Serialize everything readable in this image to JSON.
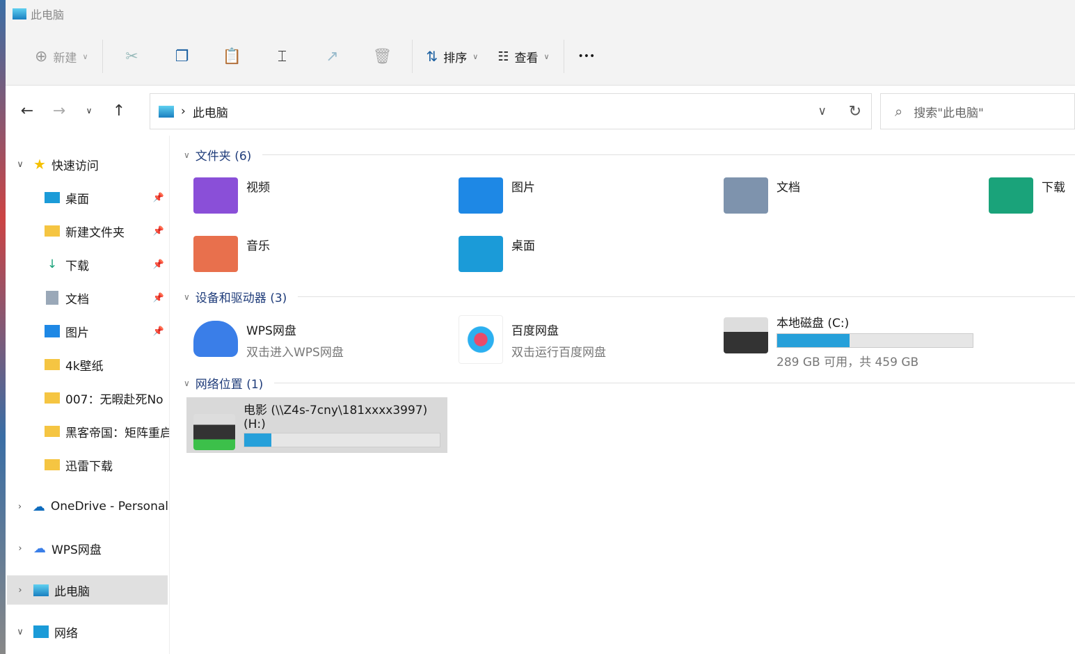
{
  "window": {
    "title": "此电脑"
  },
  "toolbar": {
    "new": "新建",
    "sort": "排序",
    "view": "查看",
    "more": "•••"
  },
  "address": {
    "path": "此电脑",
    "search_placeholder": "搜索\"此电脑\""
  },
  "sidebar": {
    "quick_access": "快速访问",
    "items": [
      {
        "label": "桌面"
      },
      {
        "label": "新建文件夹"
      },
      {
        "label": "下载"
      },
      {
        "label": "文档"
      },
      {
        "label": "图片"
      },
      {
        "label": "4k壁纸"
      },
      {
        "label": "007：无暇赴死No"
      },
      {
        "label": "黑客帝国：矩阵重启"
      },
      {
        "label": "迅雷下载"
      }
    ],
    "onedrive": "OneDrive - Personal",
    "wps": "WPS网盘",
    "this_pc": "此电脑",
    "network": "网络"
  },
  "groups": {
    "folders": "文件夹 (6)",
    "devices": "设备和驱动器 (3)",
    "network": "网络位置 (1)"
  },
  "folders": [
    {
      "label": "视频",
      "color": "#8a4fd8"
    },
    {
      "label": "图片",
      "color": "#1e88e5"
    },
    {
      "label": "文档",
      "color": "#7e93ad"
    },
    {
      "label": "下载",
      "color": "#1aa37a"
    },
    {
      "label": "音乐",
      "color": "#e8704d"
    },
    {
      "label": "桌面",
      "color": "#1b9bd8"
    }
  ],
  "devices": [
    {
      "name": "WPS网盘",
      "sub": "双击进入WPS网盘"
    },
    {
      "name": "百度网盘",
      "sub": "双击运行百度网盘"
    },
    {
      "name": "本地磁盘 (C:)",
      "sub": "289 GB 可用，共 459 GB",
      "used_percent": 37
    }
  ],
  "network_drive": {
    "name": "电影 (\\\\Z4s-7cny\\181xxxx3997)",
    "letter": "(H:)",
    "used_percent": 14
  }
}
